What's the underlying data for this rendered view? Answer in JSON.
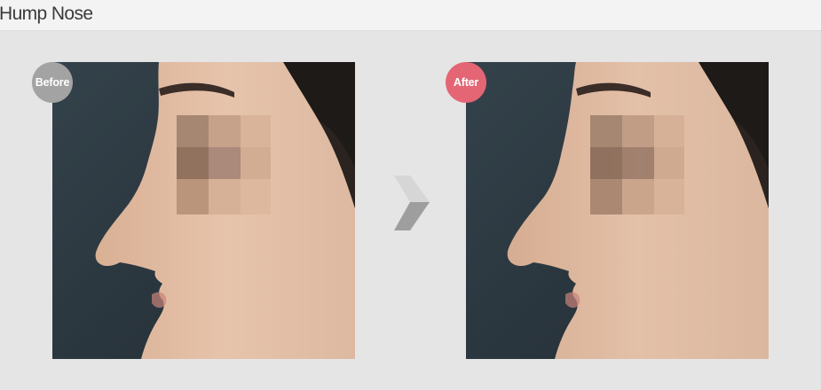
{
  "header": {
    "title": "Hump Nose"
  },
  "comparison": {
    "before_label": "Before",
    "after_label": "After",
    "before_badge_color": "#a3a3a3",
    "after_badge_color": "#e46675",
    "arrow_icon": "chevron-right-icon"
  },
  "colors": {
    "background": "#e5e5e5",
    "header_background": "#f3f3f3",
    "photo_backdrop": "#2d3a42",
    "skin": "#e2bfa6"
  }
}
